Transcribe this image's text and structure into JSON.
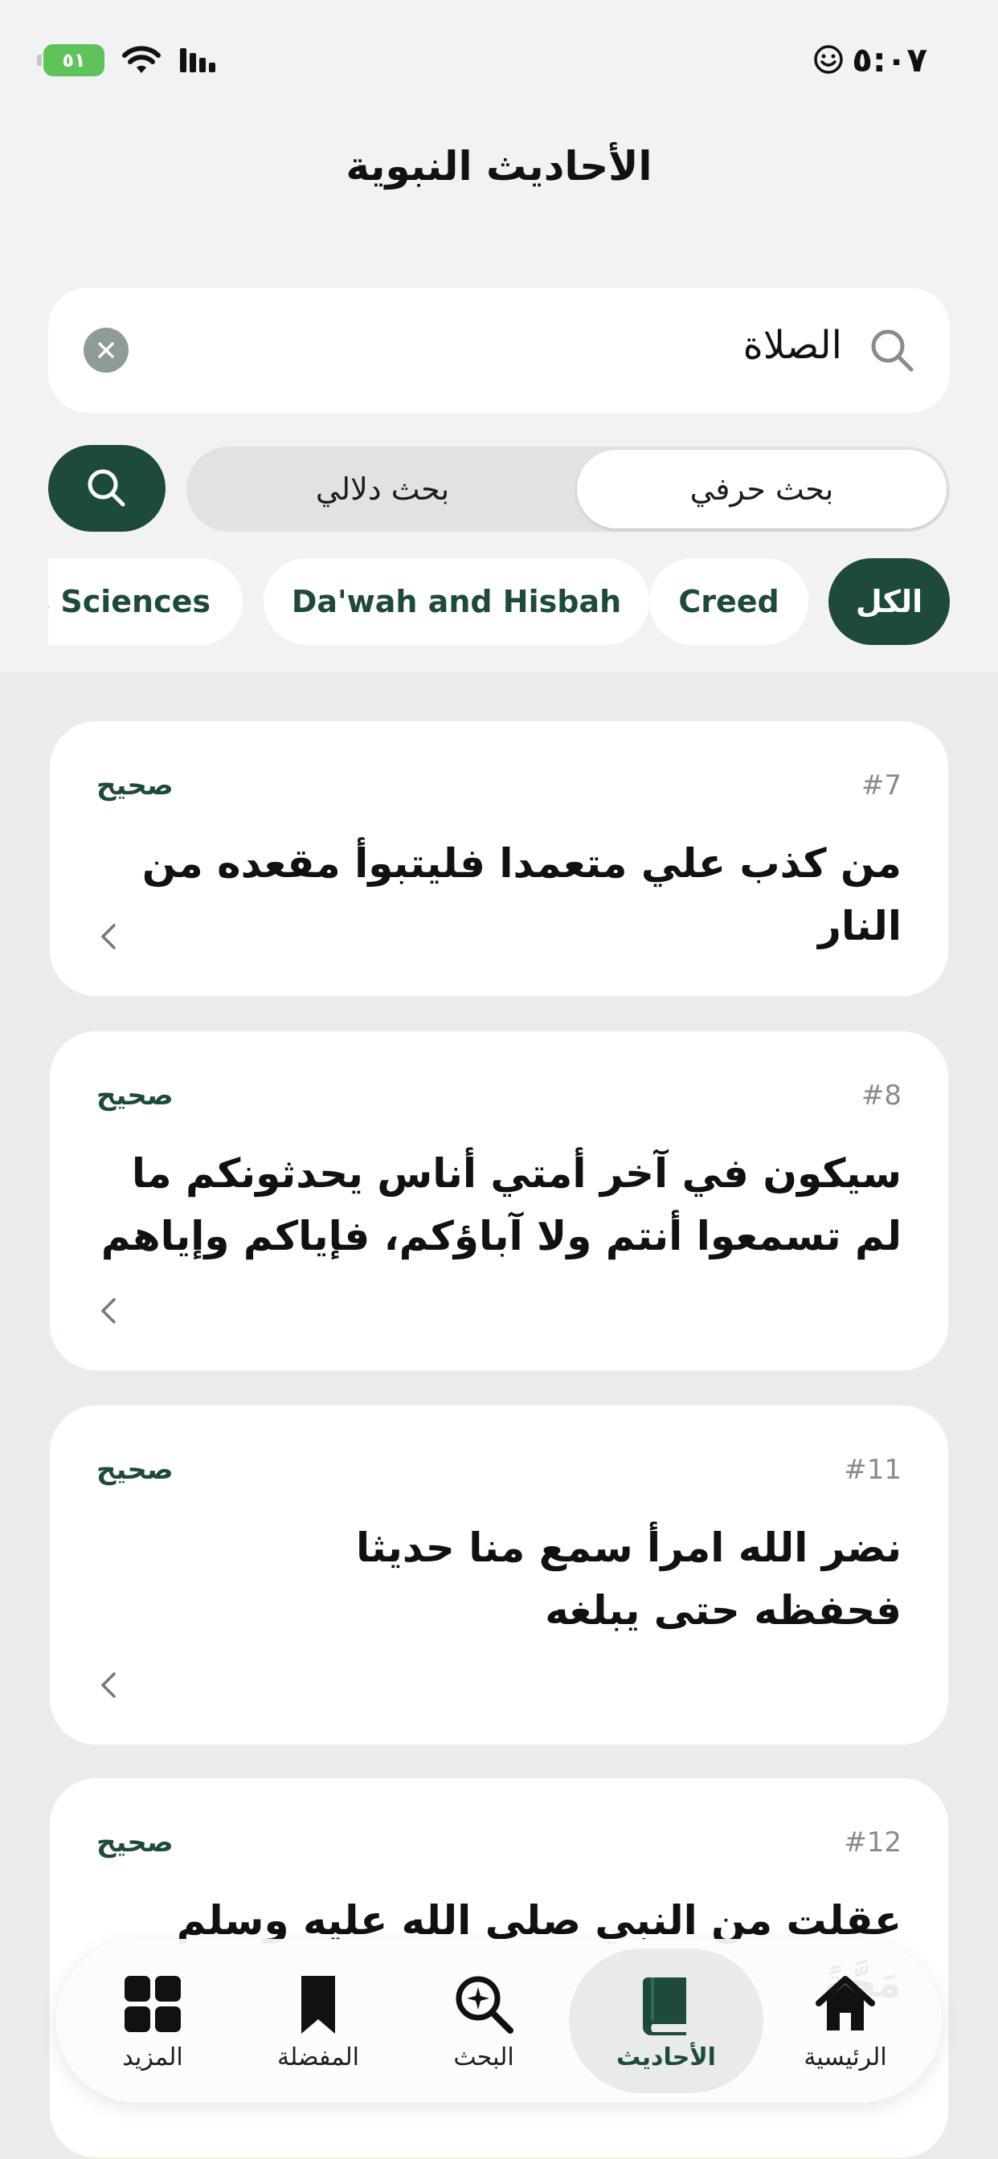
{
  "status_bar": {
    "time": "٥:٠٧",
    "battery": "٥١"
  },
  "header": {
    "title": "الأحاديث النبوية"
  },
  "search": {
    "query": "الصلاة"
  },
  "search_mode": {
    "literal": "بحث حرفي",
    "semantic": "بحث دلالي",
    "selected": "بحث حرفي"
  },
  "categories": [
    "الكل",
    "Creed",
    "Da'wah and Hisbah",
    "s Sciences"
  ],
  "hadiths": [
    {
      "number": "#7",
      "grade": "صحيح",
      "text": "من كذب علي متعمدا فليتبوأ مقعده من النار"
    },
    {
      "number": "#8",
      "grade": "صحيح",
      "text": "سيكون في آخر أمتي أناس يحدثونكم ما لم تسمعوا أنتم ولا آباؤكم، فإياكم وإياهم"
    },
    {
      "number": "#11",
      "grade": "صحيح",
      "text": "نضر الله امرأ سمع منا حديثا فحفظه حتى يبلغه"
    },
    {
      "number": "#12",
      "grade": "صحيح",
      "text": "عقلت من النبي صلى الله عليه وسلم مَجَّةً"
    }
  ],
  "nav": {
    "home": "الرئيسية",
    "hadiths": "الأحاديث",
    "search": "البحث",
    "favorites": "المفضلة",
    "more": "المزيد",
    "active": "الأحاديث"
  },
  "colors": {
    "accent": "#1e4a3b",
    "background": "#ebebee",
    "card": "#ffffff"
  }
}
